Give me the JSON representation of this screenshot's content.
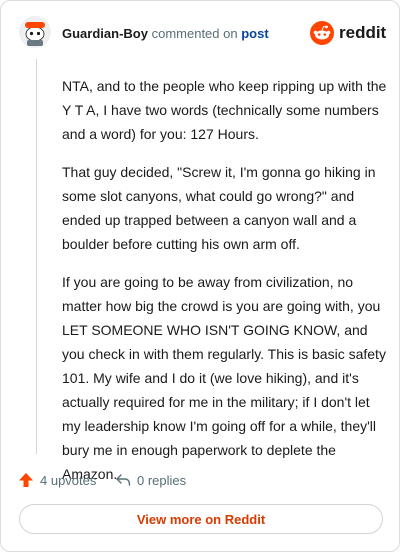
{
  "header": {
    "username": "Guardian-Boy",
    "action_text": "commented on",
    "post_link": "post",
    "brand": "reddit"
  },
  "comment": {
    "paragraphs": [
      "NTA, and to the people who keep ripping up with the Y T A, I have two words (technically some numbers and a word) for you: 127 Hours.",
      "That guy decided, \"Screw it, I'm gonna go hiking in some slot canyons, what could go wrong?\" and ended up trapped between a canyon wall and a boulder before cutting his own arm off.",
      "If you are going to be away from civilization, no matter how big the crowd is you are going with, you LET SOMEONE WHO ISN'T GOING KNOW, and you check in with them regularly. This is basic safety 101. My wife and I do it (we love hiking), and it's actually required for me in the military; if I don't let my leadership know I'm going off for a while, they'll bury me in enough paperwork to deplete the Amazon."
    ]
  },
  "actions": {
    "upvotes": "4 upvotes",
    "replies": "0 replies"
  },
  "footer": {
    "view_more": "View more on Reddit"
  },
  "colors": {
    "brand_orange": "#ff4500",
    "upvote_orange": "#ff4500",
    "link_blue": "#0a449b",
    "view_more_red": "#d93a00"
  }
}
